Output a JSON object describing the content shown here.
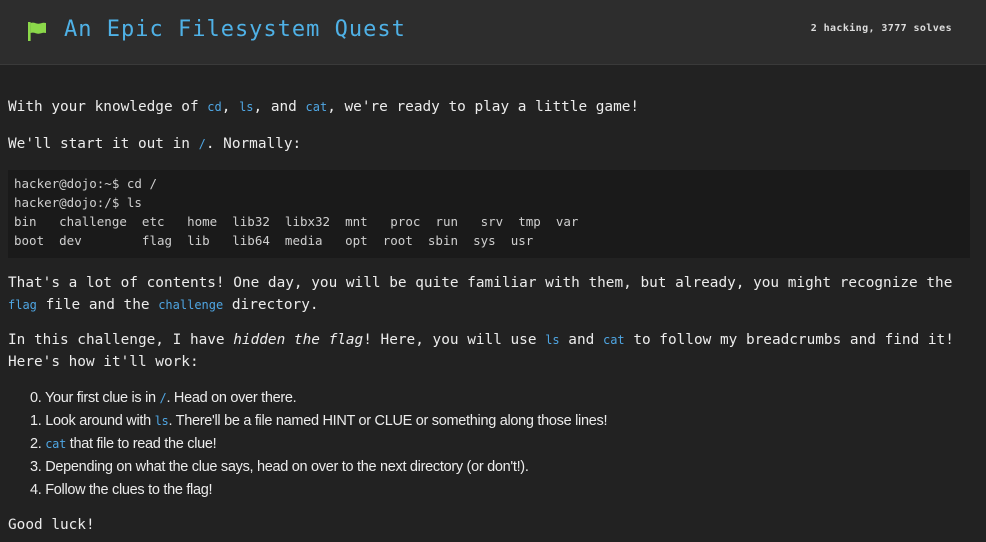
{
  "header": {
    "icon": "flag-icon",
    "title": "An Epic Filesystem Quest",
    "stats": "2 hacking, 3777 solves"
  },
  "colors": {
    "accent": "#4fb1e6",
    "flag": "#8bd84a",
    "background": "#222222",
    "header_bg": "#2d2d2d",
    "code_bg": "#1a1a1a"
  },
  "intro": {
    "t1": "With your knowledge of ",
    "c1": "cd",
    "t2": ", ",
    "c2": "ls",
    "t3": ", and ",
    "c3": "cat",
    "t4": ", we're ready to play a little game!"
  },
  "start": {
    "t1": "We'll start it out in ",
    "c1": "/",
    "t2": ". Normally:"
  },
  "terminal": {
    "lines": [
      "hacker@dojo:~$ cd /",
      "hacker@dojo:/$ ls",
      "bin   challenge  etc   home  lib32  libx32  mnt   proc  run   srv  tmp  var",
      "boot  dev        flag  lib   lib64  media   opt  root  sbin  sys  usr"
    ]
  },
  "contents": {
    "t1": "That's a lot of contents! One day, you will be quite familiar with them, but already, you might recognize the ",
    "c1": "flag",
    "t2": " file and the ",
    "c2": "challenge",
    "t3": " directory."
  },
  "challenge": {
    "t1": "In this challenge, I have ",
    "em": "hidden the flag",
    "t2": "! Here, you will use ",
    "c1": "ls",
    "t3": " and ",
    "c2": "cat",
    "t4": " to follow my breadcrumbs and find it! Here's how it'll work:"
  },
  "steps": {
    "s0": {
      "t1": "0. Your first clue is in ",
      "c1": "/",
      "t2": ". Head on over there."
    },
    "s1": {
      "t1": "1. Look around with ",
      "c1": "ls",
      "t2": ". There'll be a file named HINT or CLUE or something along those lines!"
    },
    "s2": {
      "t1": "2. ",
      "c1": "cat",
      "t2": " that file to read the clue!"
    },
    "s3": {
      "t1": "3. Depending on what the clue says, head on over to the next directory (or don't!)."
    },
    "s4": {
      "t1": "4. Follow the clues to the flag!"
    }
  },
  "closing": "Good luck!"
}
